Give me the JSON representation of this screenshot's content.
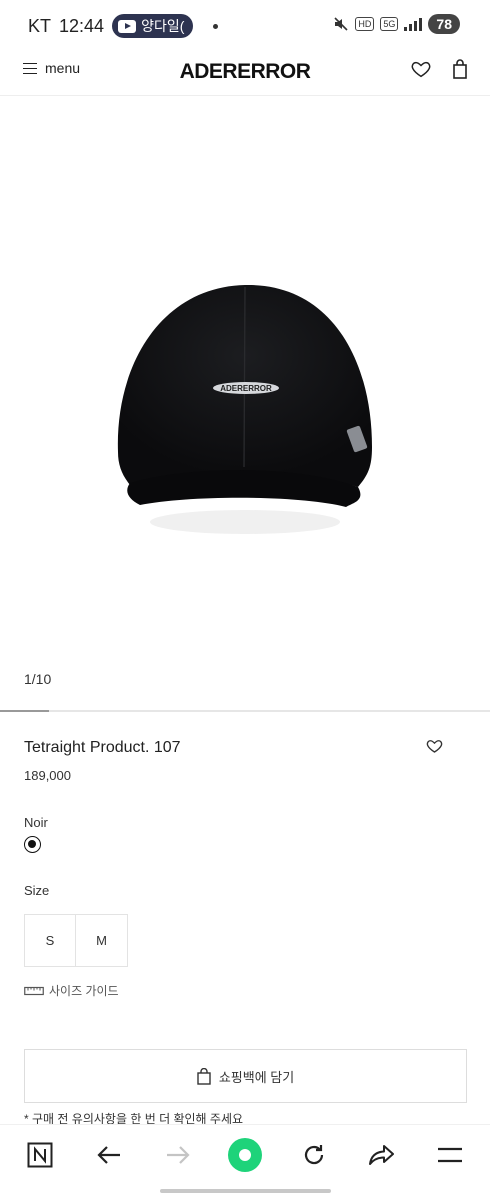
{
  "status_bar": {
    "carrier": "KT",
    "time": "12:44",
    "media_pill": "양다일(",
    "network_badge_hd": "HD",
    "network_badge_5g": "5G",
    "battery": "78"
  },
  "header": {
    "menu_label": "menu",
    "brand": "ADERERROR"
  },
  "gallery": {
    "pager": "1/10",
    "progress": 0.1,
    "cap_logo_text": "ADERERROR"
  },
  "product": {
    "name": "Tetraight Product. 107",
    "price": "189,000",
    "color_label": "Noir",
    "size_label": "Size",
    "sizes": [
      "S",
      "M"
    ],
    "size_guide": "사이즈 가이드",
    "add_to_bag": "쇼핑백에 담기",
    "notice": "* 구매 전 유의사항을 한 번 더 확인해 주세요"
  },
  "browser_nav": {
    "items": [
      "n-logo-icon",
      "back-arrow-icon",
      "forward-arrow-icon",
      "home-circle-icon",
      "refresh-icon",
      "share-icon",
      "menu-lines-icon"
    ],
    "accent": "#1ed37a"
  }
}
